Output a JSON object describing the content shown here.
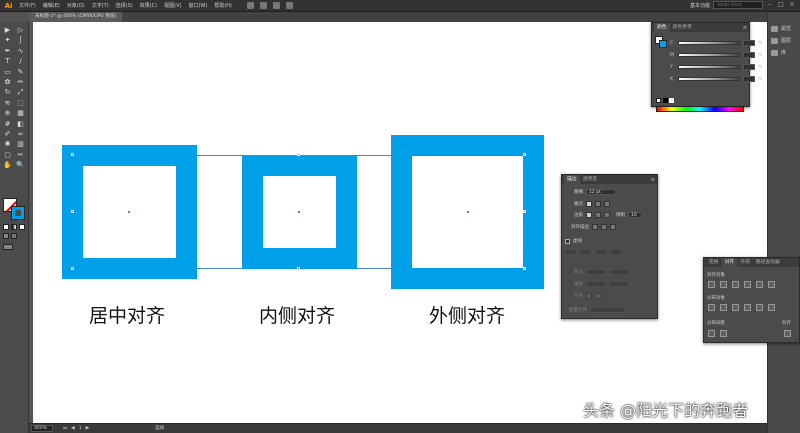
{
  "app": {
    "logo": "Ai"
  },
  "menu": [
    "文件(F)",
    "编辑(E)",
    "对象(O)",
    "文字(T)",
    "选择(S)",
    "效果(C)",
    "视图(V)",
    "窗口(W)",
    "帮助(H)"
  ],
  "topbar": {
    "workspace": "基本功能",
    "search_placeholder": "Adobe Stock"
  },
  "document": {
    "tab_title": "未标题-1* @ 400% (CMYK/GPU 预览)"
  },
  "colors": {
    "accent": "#00a0e9",
    "background_ui": "#535353",
    "artboard": "#ffffff",
    "selection": "#4f7fe0"
  },
  "tools": [
    "selection-icon",
    "direct-select-icon",
    "magic-wand-icon",
    "lasso-icon",
    "pen-icon",
    "curvature-icon",
    "type-icon",
    "line-icon",
    "rectangle-icon",
    "paintbrush-icon",
    "shaper-icon",
    "pencil-icon",
    "rotate-icon",
    "scale-icon",
    "width-icon",
    "free-transform-icon",
    "shape-builder-icon",
    "perspective-icon",
    "mesh-icon",
    "gradient-icon",
    "eyedropper-icon",
    "blend-icon",
    "symbol-sprayer-icon",
    "column-graph-icon",
    "artboard-icon",
    "slice-icon",
    "hand-icon",
    "zoom-icon"
  ],
  "tool_glyphs": [
    "▶",
    "▷",
    "✦",
    "ʃ",
    "✒",
    "∿",
    "T",
    "/",
    "▭",
    "✎",
    "✿",
    "✏",
    "↻",
    "⤢",
    "≋",
    "⬚",
    "⊕",
    "▦",
    "#",
    "◧",
    "✐",
    "∞",
    "✺",
    "▥",
    "▢",
    "✂",
    "✋",
    "🔍"
  ],
  "canvas": {
    "captions": [
      "居中对齐",
      "内侧对齐",
      "外侧对齐"
    ],
    "watermark": "头条 @阳光下的奔跑者"
  },
  "status": {
    "zoom": "400%",
    "page": "1",
    "mode": "选择"
  },
  "right_dock": [
    "属性",
    "图层",
    "库"
  ],
  "color_panel": {
    "tabs": [
      "颜色",
      "颜色参考"
    ],
    "channels": [
      "C",
      "M",
      "Y",
      "K"
    ],
    "percent": "%"
  },
  "stroke_panel": {
    "tabs": [
      "描边",
      "透明度"
    ],
    "weight_label": "粗细",
    "weight_value": "12 pt",
    "cap_label": "端点",
    "corner_label": "边角",
    "limit_label": "限制",
    "limit_value": "10",
    "align_label": "对齐描边",
    "dashed_label": "虚线",
    "arrow_label": "箭头",
    "scale_label": "缩放",
    "align2_label": "对齐",
    "profile_label": "配置文件"
  },
  "align_panel": {
    "tabs": [
      "变换",
      "对齐",
      "外观",
      "路径查找器"
    ],
    "align_objects": "对齐对象",
    "distribute_objects": "分布对象",
    "distribute_spacing": "分布间距",
    "align_to": "对齐"
  }
}
